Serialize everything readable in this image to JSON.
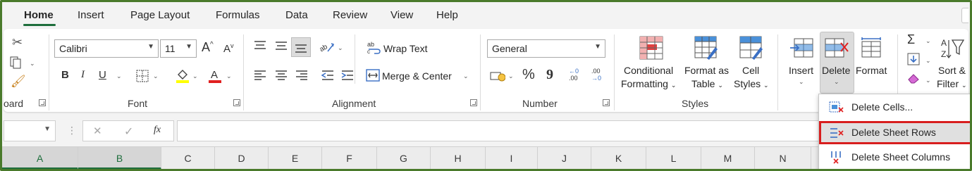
{
  "tabs": [
    "Home",
    "Insert",
    "Page Layout",
    "Formulas",
    "Data",
    "Review",
    "View",
    "Help"
  ],
  "clipboard": {
    "group_label": "oard"
  },
  "font": {
    "group_label": "Font",
    "name": "Calibri",
    "size": "11",
    "bold": "B",
    "italic": "I",
    "underline": "U",
    "grow": "A",
    "shrink": "A"
  },
  "alignment": {
    "group_label": "Alignment",
    "wrap_text": "Wrap Text",
    "merge_center": "Merge & Center"
  },
  "number": {
    "group_label": "Number",
    "format": "General",
    "percent": "%",
    "comma": "9",
    "inc_decimal_top": "←0",
    "inc_decimal_bottom": ".00",
    "dec_decimal_top": ".00",
    "dec_decimal_bottom": "→0"
  },
  "styles": {
    "group_label": "Styles",
    "conditional": [
      "Conditional",
      "Formatting"
    ],
    "format_as": [
      "Format as",
      "Table"
    ],
    "cell": [
      "Cell",
      "Styles"
    ]
  },
  "cells": {
    "insert": "Insert",
    "delete": "Delete",
    "format": "Format"
  },
  "editing": {
    "sort": "Sort &",
    "filter": "Filter"
  },
  "formula_bar": {
    "cancel": "✕",
    "enter": "✓",
    "fx": "fx"
  },
  "columns": [
    "A",
    "B",
    "C",
    "D",
    "E",
    "F",
    "G",
    "H",
    "I",
    "J",
    "K",
    "L",
    "M",
    "N"
  ],
  "delete_menu": [
    "Delete Cells...",
    "Delete Sheet Rows",
    "Delete Sheet Columns"
  ],
  "colors": {
    "accent_green": "#1e6e3c",
    "highlight_red": "#d81e1e",
    "frame_green": "#4a7a2b"
  }
}
